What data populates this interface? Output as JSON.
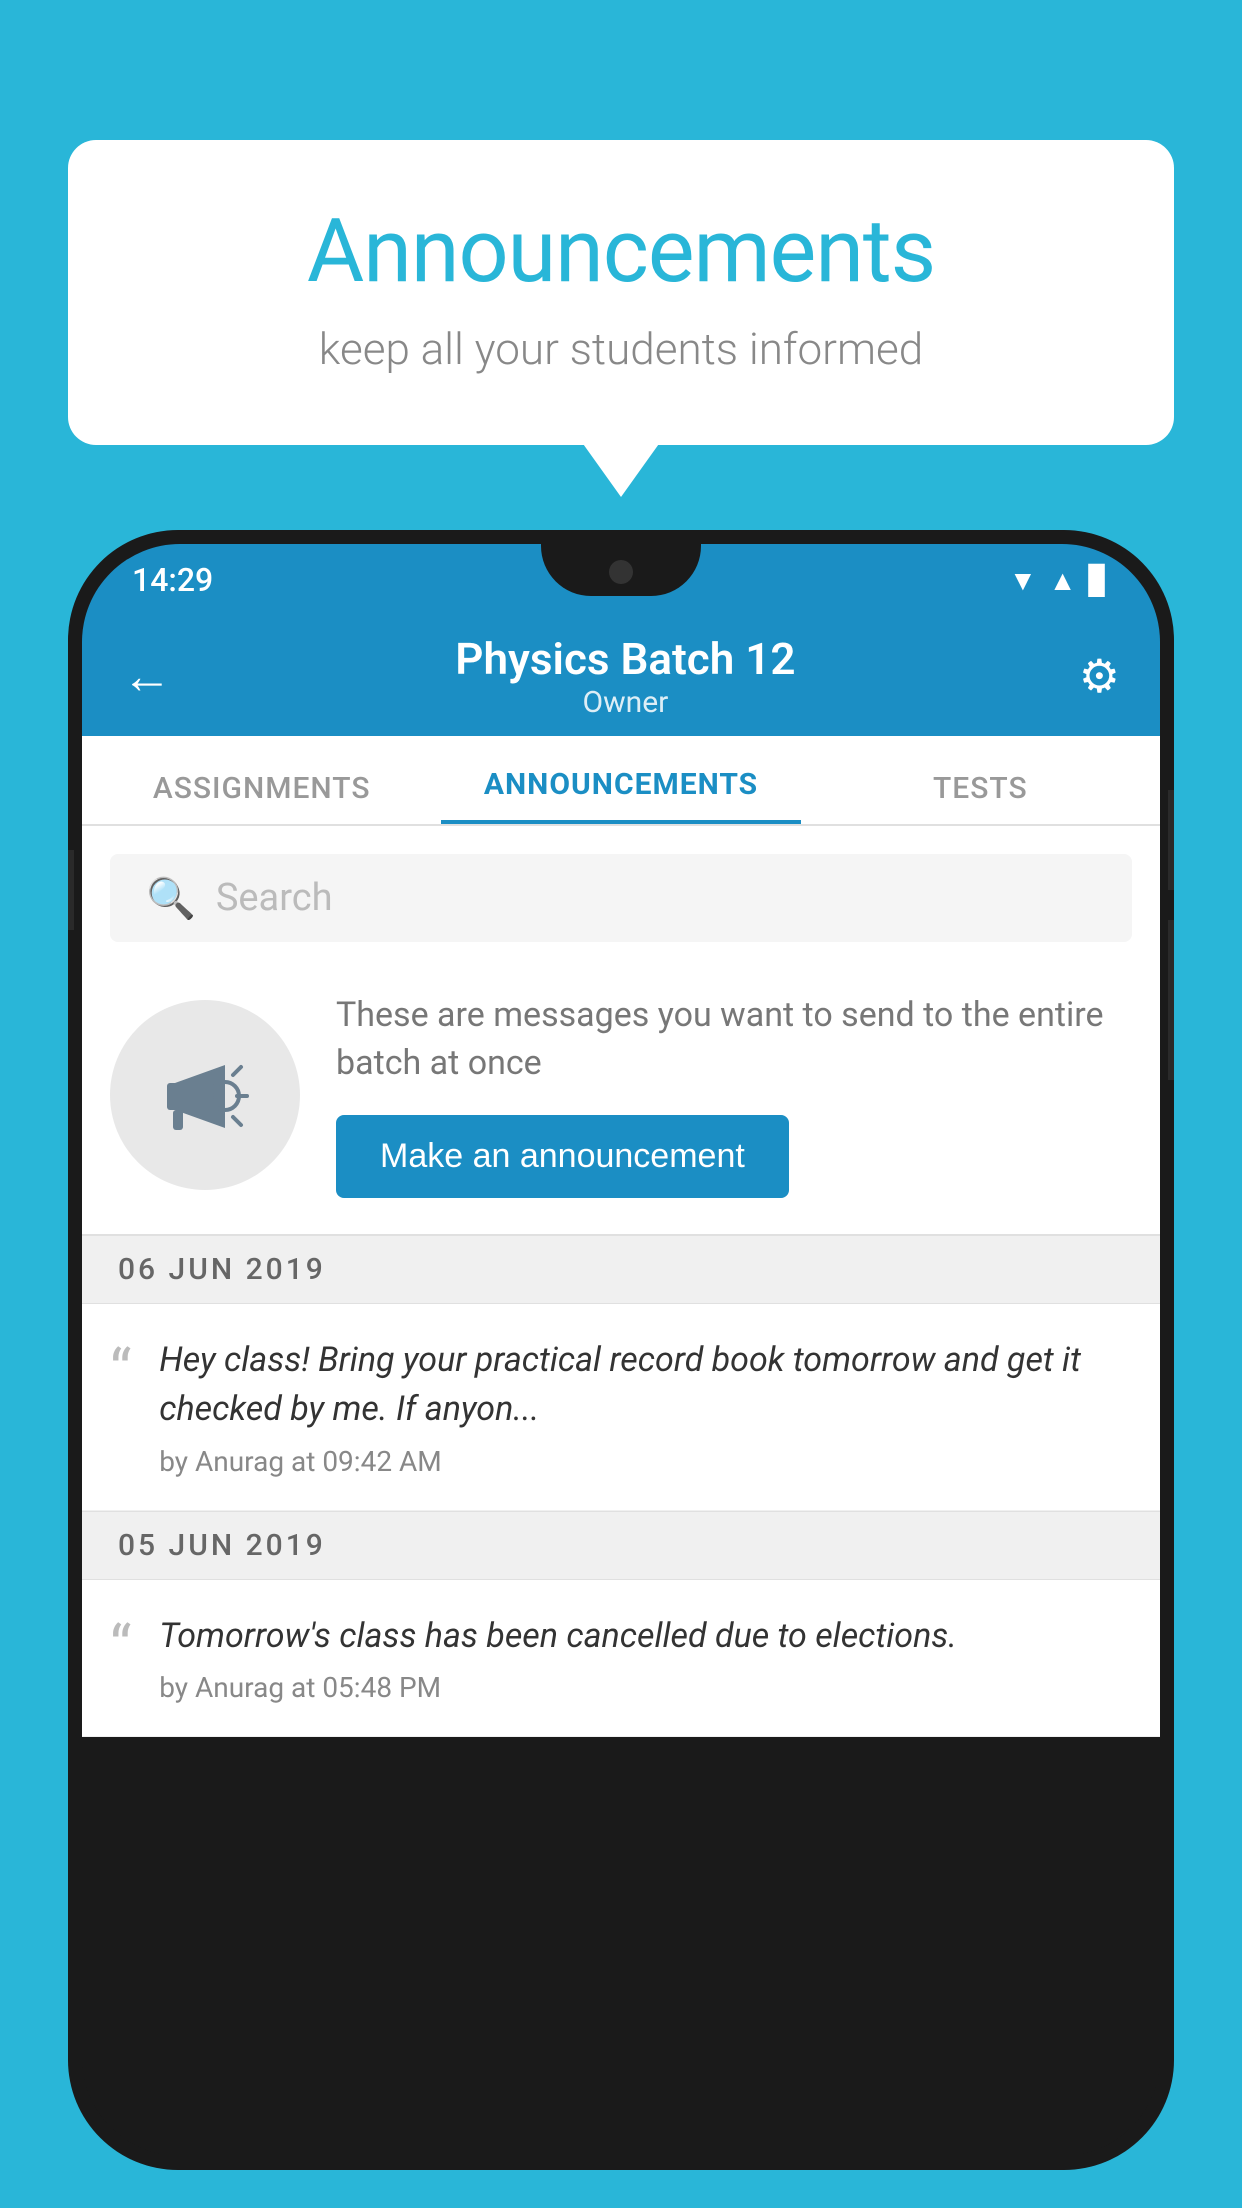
{
  "background_color": "#29b6d8",
  "speech_bubble": {
    "title": "Announcements",
    "subtitle": "keep all your students informed"
  },
  "phone": {
    "status_bar": {
      "time": "14:29",
      "icons": [
        "▲",
        "▲",
        "▊"
      ]
    },
    "app_bar": {
      "back_label": "←",
      "title": "Physics Batch 12",
      "subtitle": "Owner",
      "settings_icon": "⚙"
    },
    "tabs": [
      {
        "label": "ASSIGNMENTS",
        "active": false
      },
      {
        "label": "ANNOUNCEMENTS",
        "active": true
      },
      {
        "label": "TESTS",
        "active": false
      }
    ],
    "search": {
      "placeholder": "Search"
    },
    "announcement_placeholder": {
      "description": "These are messages you want to send to the entire batch at once",
      "button_label": "Make an announcement"
    },
    "announcement_groups": [
      {
        "date": "06  JUN  2019",
        "items": [
          {
            "message": "Hey class! Bring your practical record book tomorrow and get it checked by me. If anyon...",
            "meta": "by Anurag at 09:42 AM"
          }
        ]
      },
      {
        "date": "05  JUN  2019",
        "items": [
          {
            "message": "Tomorrow's class has been cancelled due to elections.",
            "meta": "by Anurag at 05:48 PM"
          }
        ]
      }
    ]
  }
}
